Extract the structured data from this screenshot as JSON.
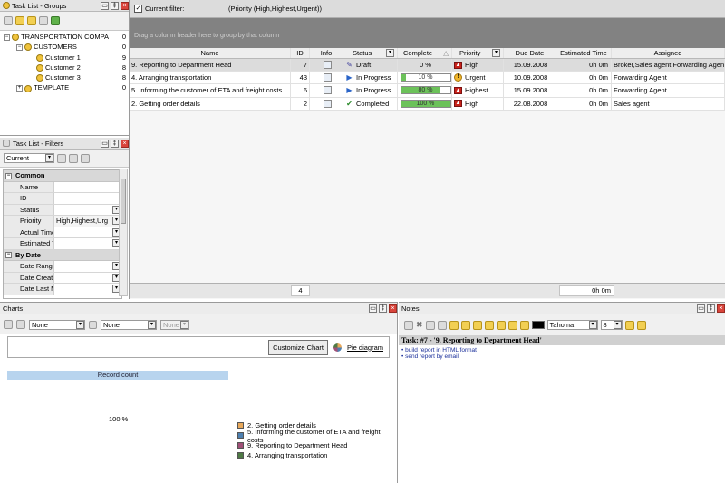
{
  "groups": {
    "title": "Task List - Groups",
    "tree": [
      {
        "label": "TRANSPORTATION COMPA",
        "count": "0"
      },
      {
        "label": "CUSTOMERS",
        "count": "0"
      },
      {
        "label": "Customer 1",
        "count": "9"
      },
      {
        "label": "Customer 2",
        "count": "8"
      },
      {
        "label": "Customer 3",
        "count": "8"
      },
      {
        "label": "TEMPLATE",
        "count": "0"
      }
    ]
  },
  "filters": {
    "title": "Task List - Filters",
    "preset": "Current",
    "cat_common": "Common",
    "props": [
      {
        "label": "Name",
        "value": ""
      },
      {
        "label": "ID",
        "value": ""
      },
      {
        "label": "Status",
        "value": ""
      },
      {
        "label": "Priority",
        "value": "High,Highest,Urg"
      },
      {
        "label": "Actual Time",
        "value": ""
      },
      {
        "label": "Estimated T",
        "value": ""
      }
    ],
    "cat_date": "By Date",
    "date_props": [
      {
        "label": "Date Range",
        "value": ""
      },
      {
        "label": "Date Create",
        "value": ""
      },
      {
        "label": "Date Last M",
        "value": ""
      }
    ]
  },
  "grid": {
    "filter_label": "Current filter:",
    "filter_value": "(Priority  (High,Highest,Urgent))",
    "group_hint": "Drag a column header here to group by that column",
    "columns": [
      "Name",
      "ID",
      "Info",
      "Status",
      "Complete",
      "Priority",
      "Due Date",
      "Estimated Time",
      "Assigned"
    ],
    "rows": [
      {
        "name": "9. Reporting to Department Head",
        "id": "7",
        "status": "Draft",
        "complete": "0 %",
        "pct": 0,
        "priority": "High",
        "due": "15.09.2008",
        "est": "0h 0m",
        "assigned": "Broker,Sales agent,Forwarding Agent"
      },
      {
        "name": "4. Arranging transportation",
        "id": "43",
        "status": "In Progress",
        "complete": "10 %",
        "pct": 10,
        "priority": "Urgent",
        "due": "10.09.2008",
        "est": "0h 0m",
        "assigned": "Forwarding Agent"
      },
      {
        "name": "5. Informing the customer of ETA and freight costs",
        "id": "6",
        "status": "In Progress",
        "complete": "80 %",
        "pct": 80,
        "priority": "Highest",
        "due": "15.09.2008",
        "est": "0h 0m",
        "assigned": "Forwarding Agent"
      },
      {
        "name": "2. Getting order details",
        "id": "2",
        "status": "Completed",
        "complete": "100 %",
        "pct": 100,
        "priority": "High",
        "due": "22.08.2008",
        "est": "0h 0m",
        "assigned": "Sales agent"
      }
    ],
    "footer_count": "4",
    "footer_est": "0h 0m"
  },
  "charts": {
    "title": "Charts",
    "sel1": "None",
    "sel2": "None",
    "sel3": "None",
    "customize": "Customize Chart",
    "pie_link": "Pie diagram",
    "record_count": "Record count",
    "percent": "100 %",
    "legend": [
      {
        "label": "2. Getting order details",
        "color": "#e8a85a"
      },
      {
        "label": "5. Informing the customer of ETA and freight costs",
        "color": "#4d7fb0"
      },
      {
        "label": "9. Reporting to Department Head",
        "color": "#a05078"
      },
      {
        "label": "4. Arranging transportation",
        "color": "#4f7a45"
      }
    ]
  },
  "notes": {
    "title": "Notes",
    "font": "Tahoma",
    "size": "8",
    "task_title": "Task: #7 - '9. Reporting to Department Head'",
    "items": [
      "build report in HTML format",
      "send report by email"
    ]
  }
}
